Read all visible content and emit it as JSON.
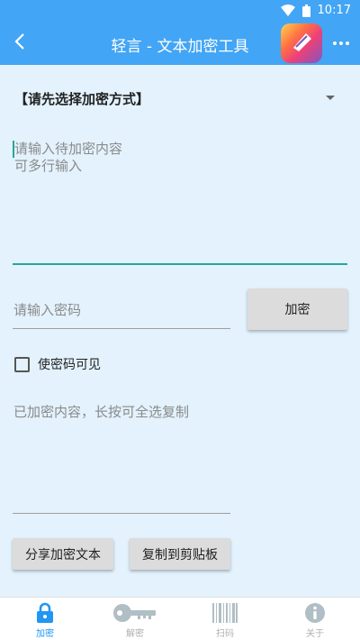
{
  "status_bar": {
    "time": "10:17"
  },
  "app_bar": {
    "title": "轻言 - 文本加密工具"
  },
  "spinner": {
    "selected": "【请先选择加密方式】"
  },
  "content_input": {
    "placeholder": "请输入待加密内容\n可多行输入"
  },
  "password_input": {
    "placeholder": "请输入密码"
  },
  "encrypt_button": {
    "label": "加密"
  },
  "show_password": {
    "label": "使密码可见",
    "checked": false
  },
  "result_output": {
    "placeholder": "已加密内容，长按可全选复制"
  },
  "share_button": {
    "label": "分享加密文本"
  },
  "copy_button": {
    "label": "复制到剪贴板"
  },
  "bottom_nav": {
    "items": [
      {
        "label": "加密",
        "icon": "lock-icon",
        "active": true
      },
      {
        "label": "解密",
        "icon": "key-icon",
        "active": false
      },
      {
        "label": "扫码",
        "icon": "barcode-icon",
        "active": false
      },
      {
        "label": "关于",
        "icon": "info-icon",
        "active": false
      }
    ]
  },
  "colors": {
    "primary": "#42a5f5",
    "background": "#e3f2fd",
    "accent": "#26a69a",
    "nav_active": "#2196f3"
  }
}
